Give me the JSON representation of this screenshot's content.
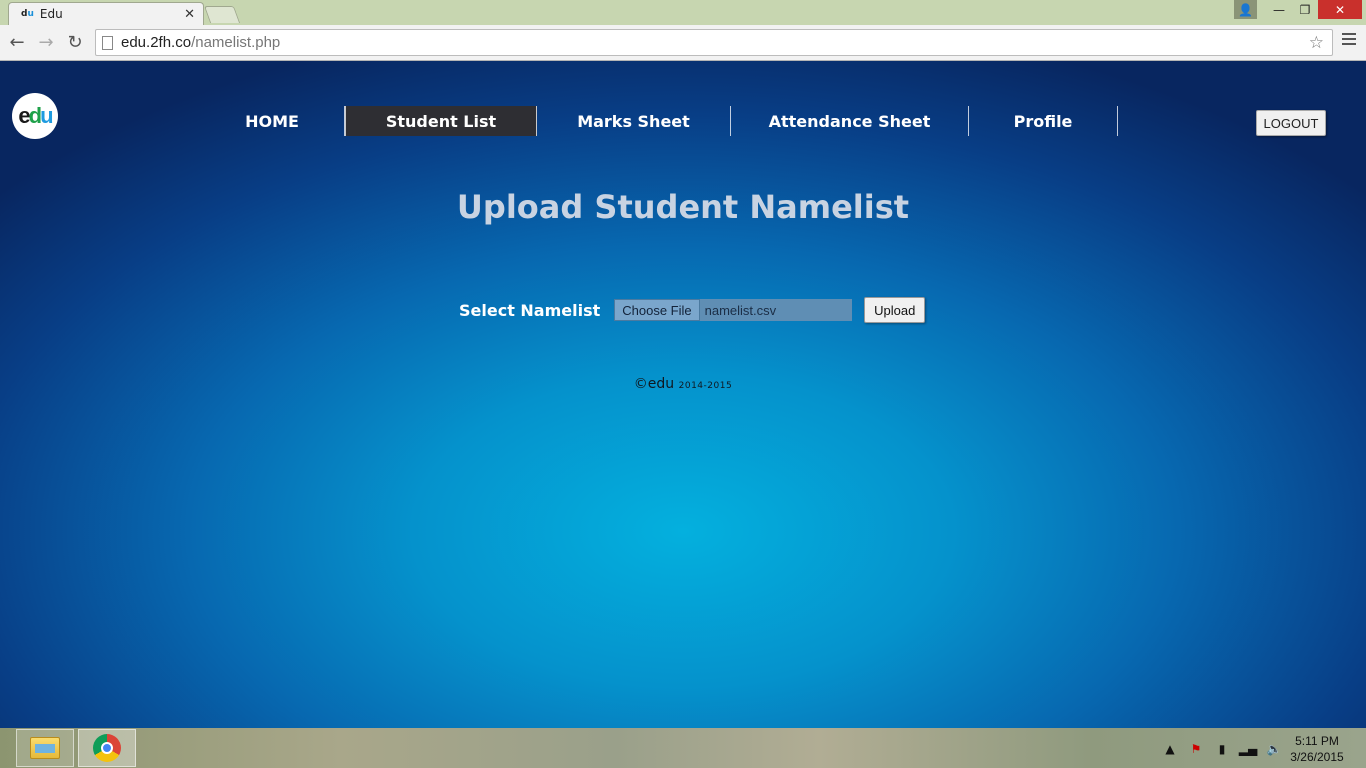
{
  "browser": {
    "tab_title": "Edu",
    "tab_favicon": "du",
    "url_host": "edu.2fh.co",
    "url_path": "/namelist.php"
  },
  "site": {
    "logo_text": {
      "e": "e",
      "d": "d",
      "u": "u"
    },
    "nav": [
      {
        "label": "HOME",
        "active": false
      },
      {
        "label": "Student List",
        "active": true
      },
      {
        "label": "Marks Sheet",
        "active": false
      },
      {
        "label": "Attendance Sheet",
        "active": false
      },
      {
        "label": "Profile",
        "active": false
      }
    ],
    "logout_label": "LOGOUT",
    "heading": "Upload Student Namelist",
    "upload": {
      "label": "Select Namelist",
      "choose_file_label": "Choose File",
      "file_name": "namelist.csv",
      "upload_label": "Upload"
    },
    "footer": {
      "brand": "©edu",
      "years": "2014-2015"
    }
  },
  "taskbar": {
    "clock_time": "5:11 PM",
    "clock_date": "3/26/2015"
  },
  "colors": {
    "active_nav_bg": "#2e2e33",
    "heading_color": "#c8d3e2",
    "page_blue": "#0592cc"
  }
}
